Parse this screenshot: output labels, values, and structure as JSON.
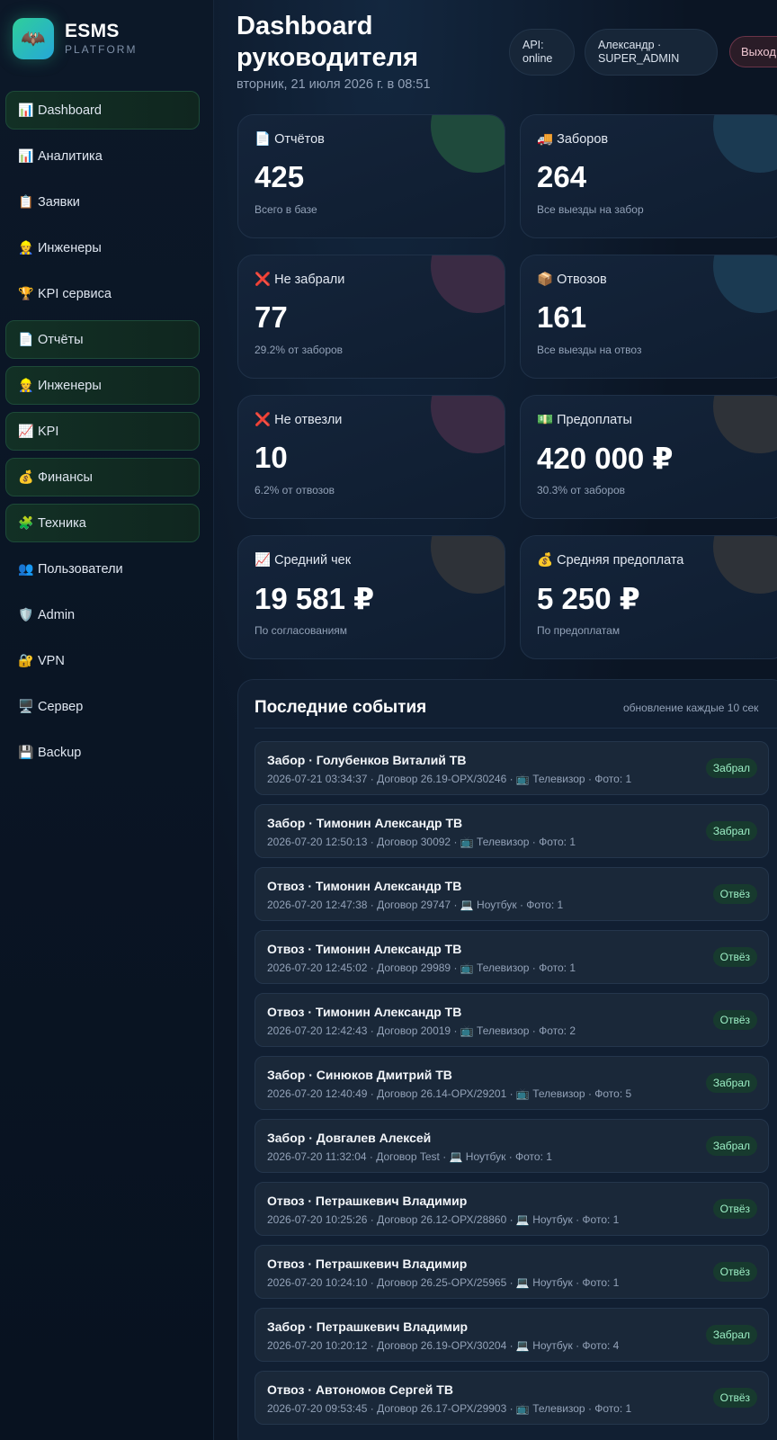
{
  "brand": {
    "name": "ESMS",
    "sub": "PLATFORM",
    "logo_icon": "🦇"
  },
  "sidebar": {
    "items": [
      {
        "icon": "📊",
        "label": "Dashboard",
        "highlight": true
      },
      {
        "icon": "📊",
        "label": "Аналитика",
        "highlight": false
      },
      {
        "icon": "📋",
        "label": "Заявки",
        "highlight": false
      },
      {
        "icon": "👷",
        "label": "Инженеры",
        "highlight": false
      },
      {
        "icon": "🏆",
        "label": "KPI сервиса",
        "highlight": false
      },
      {
        "icon": "📄",
        "label": "Отчёты",
        "highlight": true
      },
      {
        "icon": "👷",
        "label": "Инженеры",
        "highlight": true
      },
      {
        "icon": "📈",
        "label": "KPI",
        "highlight": true
      },
      {
        "icon": "💰",
        "label": "Финансы",
        "highlight": true
      },
      {
        "icon": "🧩",
        "label": "Техника",
        "highlight": true
      },
      {
        "icon": "👥",
        "label": "Пользователи",
        "highlight": false
      },
      {
        "icon": "🛡️",
        "label": "Admin",
        "highlight": false
      },
      {
        "icon": "🔐",
        "label": "VPN",
        "highlight": false
      },
      {
        "icon": "🖥️",
        "label": "Сервер",
        "highlight": false
      },
      {
        "icon": "💾",
        "label": "Backup",
        "highlight": false
      }
    ]
  },
  "header": {
    "title": "Dashboard руководителя",
    "date": "вторник, 21 июля 2026 г. в 08:51",
    "api_status": "API: online",
    "user": "Александр · SUPER_ADMIN",
    "logout": "Выход"
  },
  "stats": [
    {
      "icon": "📄",
      "label": "Отчётов",
      "value": "425",
      "sub": "Всего в базе",
      "accent": "#1f4a3c"
    },
    {
      "icon": "🚚",
      "label": "Заборов",
      "value": "264",
      "sub": "Все выезды на забор",
      "accent": "#1b3a52"
    },
    {
      "icon": "❌",
      "label": "Не забрали",
      "value": "77",
      "sub": "29.2% от заборов",
      "accent": "#3a2b44"
    },
    {
      "icon": "📦",
      "label": "Отвозов",
      "value": "161",
      "sub": "Все выезды на отвоз",
      "accent": "#1b3a52"
    },
    {
      "icon": "❌",
      "label": "Не отвезли",
      "value": "10",
      "sub": "6.2% от отвозов",
      "accent": "#3a2b44"
    },
    {
      "icon": "💵",
      "label": "Предоплаты",
      "value": "420 000 ₽",
      "sub": "30.3% от заборов",
      "accent": "#2e3238"
    },
    {
      "icon": "📈",
      "label": "Средний чек",
      "value": "19 581 ₽",
      "sub": "По согласованиям",
      "accent": "#2e3238"
    },
    {
      "icon": "💰",
      "label": "Средняя предоплата",
      "value": "5 250 ₽",
      "sub": "По предоплатам",
      "accent": "#2e3238"
    }
  ],
  "events": {
    "title": "Последние события",
    "note": "обновление каждые 10 сек",
    "items": [
      {
        "title": "Забор · Голубенков Виталий ТВ",
        "meta": "2026-07-21 03:34:37 · Договор 26.19-ОРХ/30246 · 📺 Телевизор · Фото: 1",
        "badge": "Забрал"
      },
      {
        "title": "Забор · Тимонин Александр ТВ",
        "meta": "2026-07-20 12:50:13 · Договор 30092 · 📺 Телевизор · Фото: 1",
        "badge": "Забрал"
      },
      {
        "title": "Отвоз · Тимонин Александр ТВ",
        "meta": "2026-07-20 12:47:38 · Договор 29747 · 💻 Ноутбук · Фото: 1",
        "badge": "Отвёз"
      },
      {
        "title": "Отвоз · Тимонин Александр ТВ",
        "meta": "2026-07-20 12:45:02 · Договор 29989 · 📺 Телевизор · Фото: 1",
        "badge": "Отвёз"
      },
      {
        "title": "Отвоз · Тимонин Александр ТВ",
        "meta": "2026-07-20 12:42:43 · Договор 20019 · 📺 Телевизор · Фото: 2",
        "badge": "Отвёз"
      },
      {
        "title": "Забор · Синюков Дмитрий ТВ",
        "meta": "2026-07-20 12:40:49 · Договор 26.14-ОРХ/29201 · 📺 Телевизор · Фото: 5",
        "badge": "Забрал"
      },
      {
        "title": "Забор · Довгалев Алексей",
        "meta": "2026-07-20 11:32:04 · Договор Test · 💻 Ноутбук · Фото: 1",
        "badge": "Забрал"
      },
      {
        "title": "Отвоз · Петрашкевич Владимир",
        "meta": "2026-07-20 10:25:26 · Договор 26.12-ОРХ/28860 · 💻 Ноутбук · Фото: 1",
        "badge": "Отвёз"
      },
      {
        "title": "Отвоз · Петрашкевич Владимир",
        "meta": "2026-07-20 10:24:10 · Договор 26.25-ОРХ/25965 · 💻 Ноутбук · Фото: 1",
        "badge": "Отвёз"
      },
      {
        "title": "Забор · Петрашкевич Владимир",
        "meta": "2026-07-20 10:20:12 · Договор 26.19-ОРХ/30204 · 💻 Ноутбук · Фото: 4",
        "badge": "Забрал"
      },
      {
        "title": "Отвоз · Автономов Сергей ТВ",
        "meta": "2026-07-20 09:53:45 · Договор 26.17-ОРХ/29903 · 📺 Телевизор · Фото: 1",
        "badge": "Отвёз"
      }
    ]
  }
}
